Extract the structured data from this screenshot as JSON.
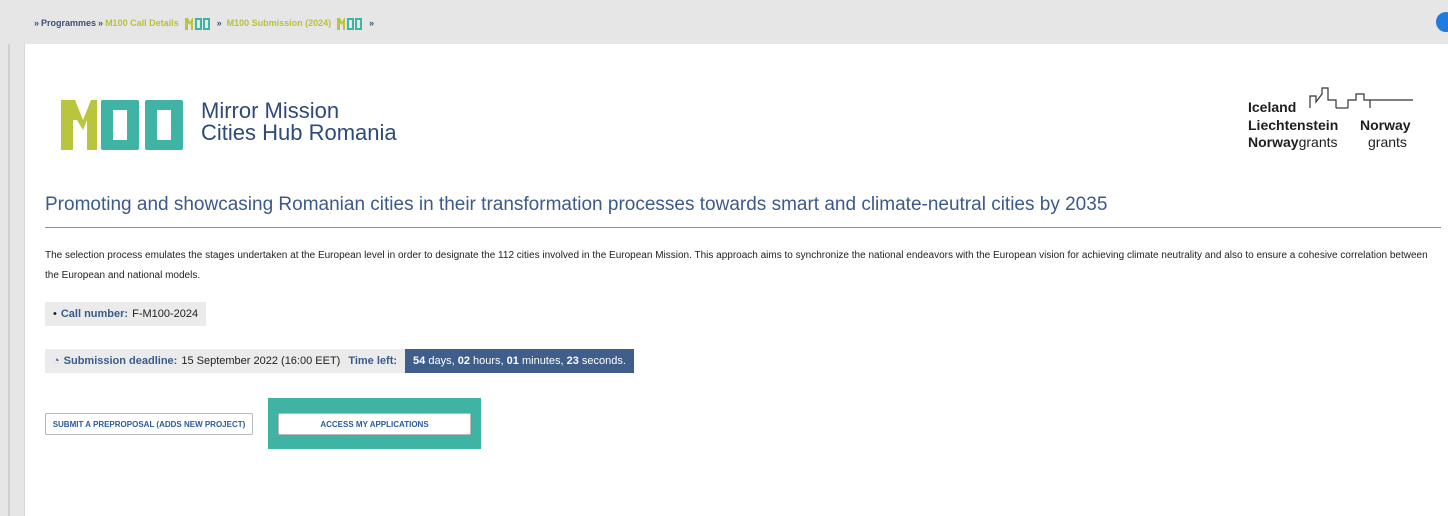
{
  "breadcrumb": {
    "sep": "»",
    "programmes": "Programmes",
    "call_details": "M100 Call Details",
    "submission": "M100 Submission (2024)"
  },
  "logo": {
    "line1": "Mirror Mission",
    "line2": "Cities Hub Romania",
    "colors": {
      "m": "#b9c53c",
      "zeros": "#3fb3a4"
    }
  },
  "grants": {
    "iceland": "Iceland",
    "liechtenstein": "Liechtenstein",
    "norway": "Norway",
    "norway_bold": "Norway",
    "grants1": "grants",
    "grants2": "grants"
  },
  "headline": "Promoting and showcasing Romanian cities in their transformation processes towards smart and climate-neutral cities by 2035",
  "description": "The selection process emulates the stages undertaken at the European level in order to designate the 112 cities involved in the European Mission. This approach aims to synchronize the national endeavors with the European vision for achieving climate neutrality and also to ensure a cohesive correlation between the European and national models.",
  "call": {
    "bullet": "•",
    "label": "Call number:",
    "value": "F-M100-2024"
  },
  "deadline": {
    "icon": "clock-icon",
    "label": "Submission deadline:",
    "value": "15 September 2022 (16:00 EET)",
    "time_left_label": "Time left:",
    "days": "54",
    "days_unit": "days,",
    "hours": "02",
    "hours_unit": "hours,",
    "minutes": "01",
    "minutes_unit": "minutes,",
    "seconds": "23",
    "seconds_unit": "seconds."
  },
  "buttons": {
    "submit": "SUBMIT A PREPROPOSAL (ADDS NEW PROJECT)",
    "access": "ACCESS MY APPLICATIONS"
  },
  "colors": {
    "accent_blue": "#3b5a8a",
    "timer_bg": "#3f5e8c",
    "highlight": "#3fb3a4",
    "brand_green": "#b9c53c"
  }
}
